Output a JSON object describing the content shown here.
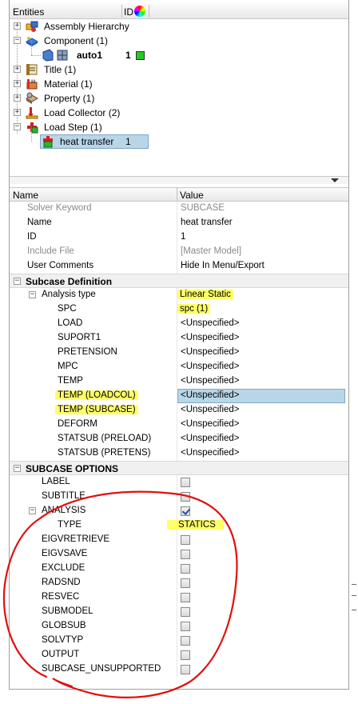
{
  "entities": {
    "header": {
      "entities": "Entities",
      "id": "ID"
    },
    "tree": [
      {
        "label": "Assembly Hierarchy",
        "icon": "assembly-icon",
        "expander": "+"
      },
      {
        "label": "Component (1)",
        "icon": "component-icon",
        "expander": "−"
      },
      {
        "label": "auto1",
        "id": "1",
        "icon": "component-part-icon",
        "color": "#22cc22"
      },
      {
        "label": "Title (1)",
        "icon": "title-icon",
        "expander": "+"
      },
      {
        "label": "Material (1)",
        "icon": "material-icon",
        "expander": "+"
      },
      {
        "label": "Property (1)",
        "icon": "property-icon",
        "expander": "+"
      },
      {
        "label": "Load Collector (2)",
        "icon": "load-collector-icon",
        "expander": "+"
      },
      {
        "label": "Load Step (1)",
        "icon": "load-step-icon",
        "expander": "−"
      },
      {
        "label": "heat transfer",
        "id": "1",
        "icon": "load-step-item-icon"
      }
    ]
  },
  "properties": {
    "header": {
      "name": "Name",
      "value": "Value"
    },
    "general": [
      {
        "name": "Solver Keyword",
        "value": "SUBCASE",
        "grey": true
      },
      {
        "name": "Name",
        "value": "heat transfer"
      },
      {
        "name": "ID",
        "value": "1"
      },
      {
        "name": "Include File",
        "value": "[Master Model]",
        "grey": true
      },
      {
        "name": "User Comments",
        "value": "Hide In Menu/Export"
      }
    ],
    "subcase_definition": {
      "title": "Subcase Definition",
      "analysis_type": {
        "name": "Analysis type",
        "value": "Linear Static"
      },
      "rows": [
        {
          "name": "SPC",
          "value": "spc (1)"
        },
        {
          "name": "LOAD",
          "value": "<Unspecified>"
        },
        {
          "name": "SUPORT1",
          "value": "<Unspecified>"
        },
        {
          "name": "PRETENSION",
          "value": "<Unspecified>"
        },
        {
          "name": "MPC",
          "value": "<Unspecified>"
        },
        {
          "name": "TEMP",
          "value": "<Unspecified>"
        },
        {
          "name": "TEMP (LOADCOL)",
          "value": "<Unspecified>"
        },
        {
          "name": "TEMP (SUBCASE)",
          "value": "<Unspecified>"
        },
        {
          "name": "DEFORM",
          "value": "<Unspecified>"
        },
        {
          "name": "STATSUB (PRELOAD)",
          "value": "<Unspecified>"
        },
        {
          "name": "STATSUB (PRETENS)",
          "value": "<Unspecified>"
        }
      ]
    },
    "subcase_options": {
      "title": "SUBCASE OPTIONS",
      "rows": [
        {
          "name": "LABEL",
          "checked": false
        },
        {
          "name": "SUBTITLE",
          "checked": false
        },
        {
          "name": "ANALYSIS",
          "checked": true
        },
        {
          "name": "TYPE",
          "value": "STATICS"
        },
        {
          "name": "EIGVRETRIEVE",
          "checked": false
        },
        {
          "name": "EIGVSAVE",
          "checked": false
        },
        {
          "name": "EXCLUDE",
          "checked": false
        },
        {
          "name": "RADSND",
          "checked": false
        },
        {
          "name": "RESVEC",
          "checked": false
        },
        {
          "name": "SUBMODEL",
          "checked": false
        },
        {
          "name": "GLOBSUB",
          "checked": false
        },
        {
          "name": "SOLVTYP",
          "checked": false
        },
        {
          "name": "OUTPUT",
          "checked": false
        },
        {
          "name": "SUBCASE_UNSUPPORTED",
          "checked": false
        }
      ]
    }
  },
  "annotation": {
    "highlight_color": "#ffff66",
    "circle_color": "#e01010"
  },
  "section_expanders": {
    "collapse": "−"
  }
}
